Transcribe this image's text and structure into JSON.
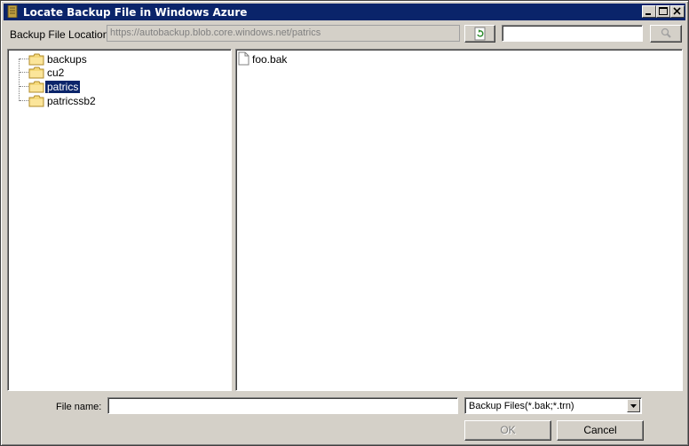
{
  "window": {
    "title": "Locate Backup File in Windows Azure",
    "controls": [
      "minimize-icon",
      "maximize-icon",
      "close-icon"
    ]
  },
  "location": {
    "label": "Backup File Location",
    "value": "https://autobackup.blob.core.windows.net/patrics",
    "refresh_icon": "refresh-icon",
    "search_value": "",
    "search_icon": "search-icon"
  },
  "tree": {
    "items": [
      {
        "label": "backups",
        "selected": false
      },
      {
        "label": "cu2",
        "selected": false
      },
      {
        "label": "patrics",
        "selected": true
      },
      {
        "label": "patricssb2",
        "selected": false
      }
    ]
  },
  "files": {
    "items": [
      {
        "label": "foo.bak",
        "icon": "file-icon"
      }
    ]
  },
  "footer": {
    "file_name_label": "File name:",
    "file_name_value": "",
    "filter_selected": "Backup Files(*.bak;*.trn)",
    "ok_label": "OK",
    "cancel_label": "Cancel"
  },
  "colors": {
    "titlebar": "#0a246a",
    "face": "#d4d0c8",
    "selection": "#0a246a"
  }
}
